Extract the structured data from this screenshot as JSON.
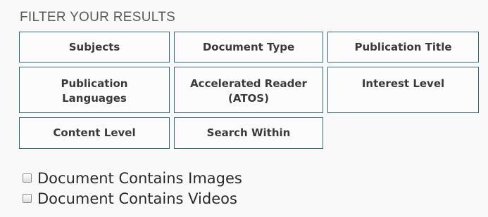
{
  "filter": {
    "heading": "FILTER YOUR RESULTS",
    "buttons": {
      "subjects": "Subjects",
      "document_type": "Document Type",
      "publication_title": "Publication Title",
      "publication_languages": "Publication\nLanguages",
      "accelerated_reader": "Accelerated Reader\n(ATOS)",
      "interest_level": "Interest Level",
      "content_level": "Content Level",
      "search_within": "Search Within"
    },
    "checkboxes": {
      "contains_images": {
        "label": "Document Contains Images",
        "checked": false
      },
      "contains_videos": {
        "label": "Document Contains Videos",
        "checked": false
      }
    }
  },
  "colors": {
    "button_border": "#2f6b80",
    "heading_text": "#5a5a5a"
  }
}
